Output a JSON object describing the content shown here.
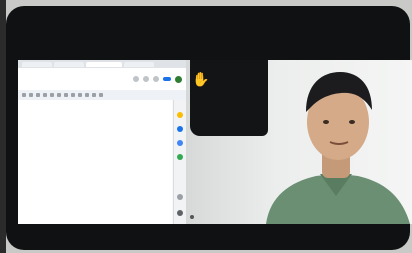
{
  "browser": {
    "tabs": [
      "",
      "",
      "",
      "",
      ""
    ]
  },
  "doc": {
    "title": "",
    "title_sub": "",
    "share_label": "",
    "lines": [
      "",
      "",
      "",
      ""
    ]
  },
  "video": {
    "participant_name_top": "",
    "participant_name_bottom": ""
  },
  "icons": {
    "raised_hand": "✋"
  },
  "colors": {
    "share": "#1a73e8",
    "shirt": "#6a8f73",
    "device": "#0f1113"
  }
}
